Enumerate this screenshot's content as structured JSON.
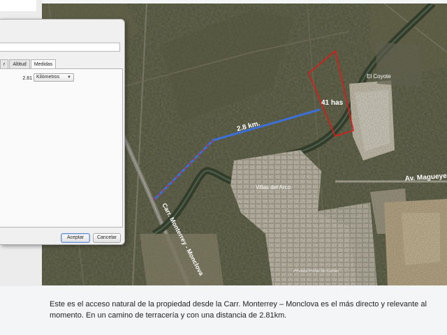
{
  "dialog": {
    "name_value": "",
    "tabs": [
      {
        "label": "r",
        "active": false
      },
      {
        "label": "Altitud",
        "active": false
      },
      {
        "label": "Medidas",
        "active": true
      }
    ],
    "measure_value": "2.81",
    "unit_selected": "Kilómetros",
    "ok_label": "Aceptar",
    "cancel_label": "Cancelar"
  },
  "map": {
    "labels": {
      "el_coyote": "El Coyote",
      "area": "41 has",
      "distance": "2.8 km.",
      "av_magueyes": "Av. Magueyes",
      "villas_del_arco": "Villas del Arco",
      "carretera": "Carr. Monterrey - Monclova",
      "faint_place": "Privada Portal de Cañas"
    },
    "colors": {
      "route": "#3d6fd8",
      "parcel": "#e01818",
      "label_text": "#ffffff"
    }
  },
  "caption": {
    "line1": "Este es el acceso natural de la propiedad desde la Carr. Monterrey – Monclova es el más directo y relevante al",
    "line2": "momento. En un camino de terracería y con una distancia de 2.81km."
  }
}
